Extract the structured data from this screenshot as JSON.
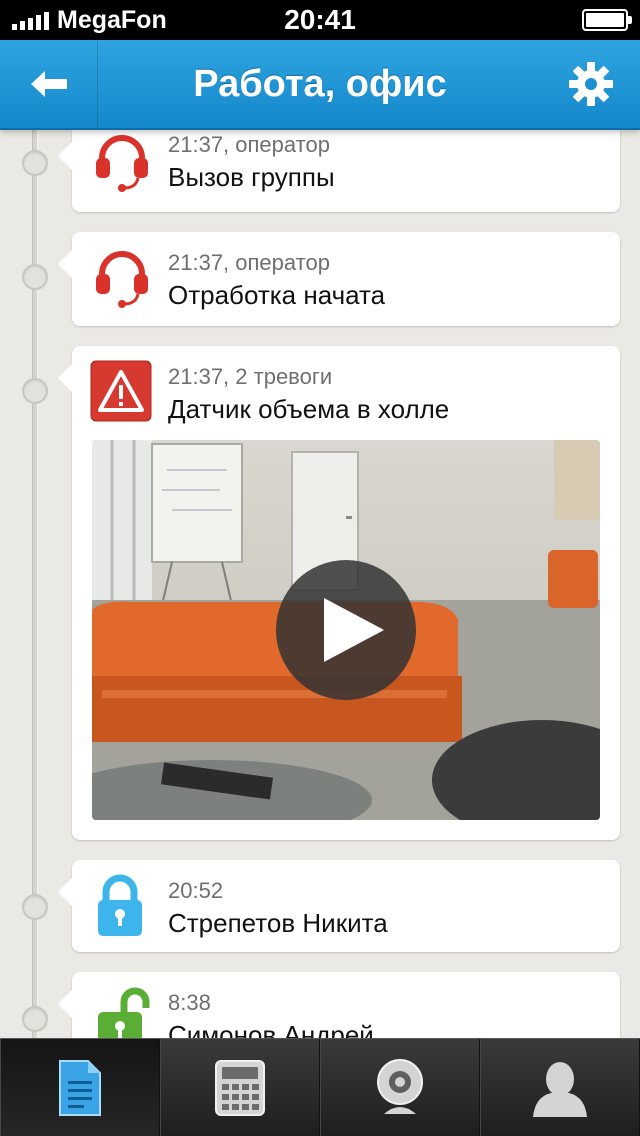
{
  "status_bar": {
    "carrier": "MegaFon",
    "time": "20:41"
  },
  "header": {
    "title": "Работа, офис",
    "back_icon": "back-arrow-icon",
    "settings_icon": "gear-icon"
  },
  "events": [
    {
      "icon": "operator-headset-icon",
      "meta": "21:37, оператор",
      "title": "Вызов группы"
    },
    {
      "icon": "operator-headset-icon",
      "meta": "21:37, оператор",
      "title": "Отработка начата"
    },
    {
      "icon": "alarm-warning-icon",
      "meta": "21:37, 2 тревоги",
      "title": "Датчик объема в холле",
      "has_video": true
    },
    {
      "icon": "lock-closed-icon",
      "meta": "20:52",
      "title": "Стрепетов Никита"
    },
    {
      "icon": "lock-open-icon",
      "meta": "8:38",
      "title": "Симонов Андрей"
    }
  ],
  "tab_bar": {
    "tabs": [
      {
        "icon": "document-icon",
        "active": true
      },
      {
        "icon": "calculator-icon",
        "active": false
      },
      {
        "icon": "webcam-icon",
        "active": false
      },
      {
        "icon": "user-icon",
        "active": false
      }
    ]
  },
  "colors": {
    "header": "#1a91d4",
    "operator_icon": "#d9322a",
    "alarm_icon": "#d5392f",
    "lock_closed": "#3db4ea",
    "lock_open": "#5aad35",
    "active_tab_icon": "#3aa3e6"
  }
}
